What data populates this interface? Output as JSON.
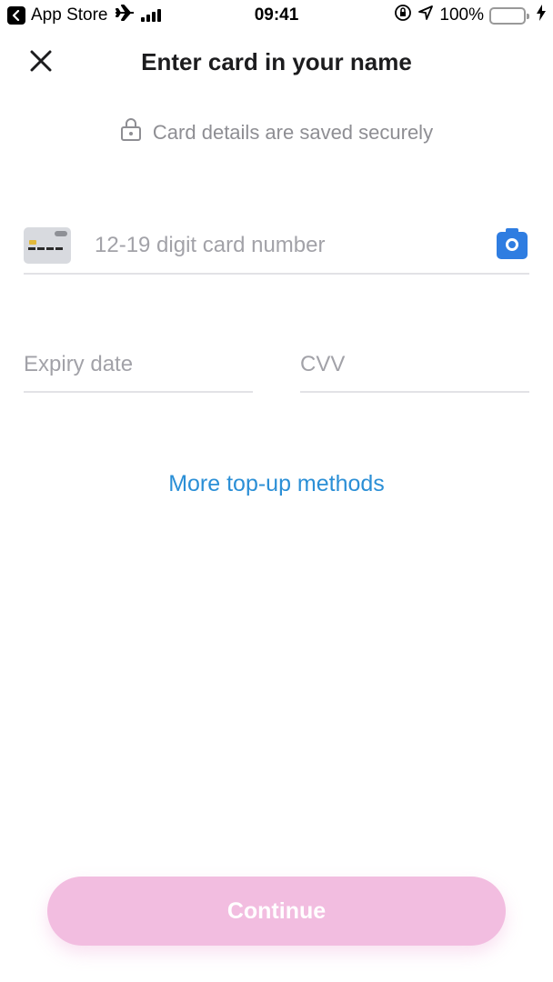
{
  "status_bar": {
    "back_app": "App Store",
    "time": "09:41",
    "battery": "100%"
  },
  "header": {
    "title": "Enter card in your name",
    "close_icon": "close-icon"
  },
  "secure_note": {
    "icon": "lock-icon",
    "text": "Card details are saved securely"
  },
  "form": {
    "card_number_placeholder": "12-19 digit card number",
    "card_number_value": "",
    "expiry_placeholder": "Expiry date",
    "expiry_value": "",
    "cvv_placeholder": "CVV",
    "cvv_value": "",
    "scan_icon": "camera-icon"
  },
  "more_methods_label": "More top-up methods",
  "continue_label": "Continue",
  "colors": {
    "accent_link": "#2b8fd6",
    "camera_button": "#2f7de1",
    "continue_disabled": "#f2bde0",
    "battery_fill": "#f5d60c"
  }
}
